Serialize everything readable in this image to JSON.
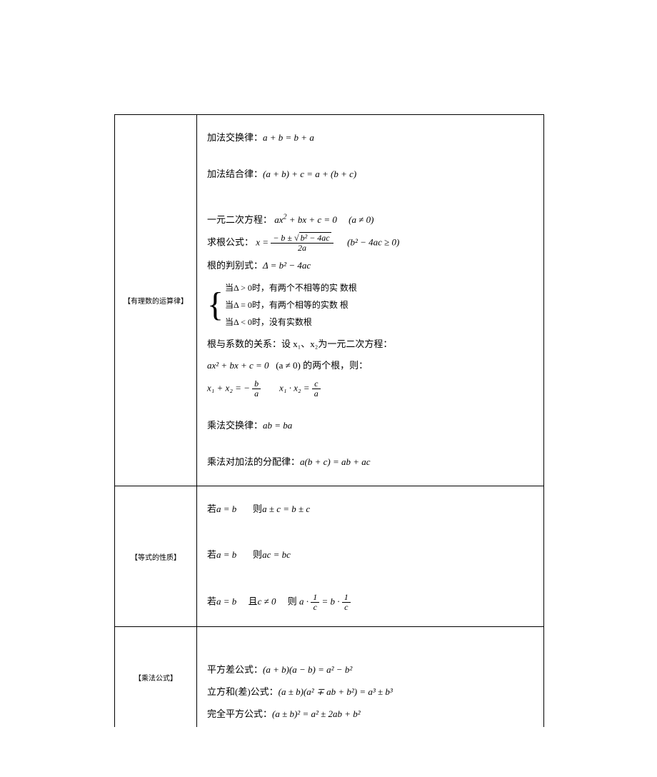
{
  "row1": {
    "label": "【有理数的运算律】",
    "l1a": "加法交换律：",
    "l1b": "a + b = b + a",
    "l2a": "加法结合律：",
    "l2b": "(a + b) + c = a + (b + c)",
    "l3a": "一元二次方程：",
    "l3b": "ax",
    "l3c": " + bx + c = 0",
    "l3d": "(a ≠ 0)",
    "l4a": "求根公式：",
    "l4b": "x = ",
    "l4num": "− b ± ",
    "l4sqrt": "b² − 4ac",
    "l4den": "2a",
    "l4c": "(b² − 4ac ≥ 0)",
    "l5a": "根的判别式：",
    "l5b": "Δ = b² − 4ac",
    "l6a": "当Δ > 0时，有两个不相等的实 数根",
    "l6b": "当Δ = 0时，有两个相等的实数 根",
    "l6c": "当Δ < 0时，没有实数根",
    "l7a": "根与系数的关系：设 x₁、x₂为一元二次方程：",
    "l8a": "ax² + bx + c = 0",
    "l8b": "(a ≠ 0) 的两个根，则：",
    "l9a": "x₁ + x₂ = − ",
    "l9n1": "b",
    "l9d1": "a",
    "l9b": "x₁ · x₂ = ",
    "l9n2": "c",
    "l9d2": "a",
    "l10a": "乘法交换律：",
    "l10b": "ab = ba",
    "l11a": "乘法对加法的分配律：",
    "l11b": "a(b + c) = ab + ac"
  },
  "row2": {
    "label": "【等式的性质】",
    "l1a": "若",
    "l1b": "a = b",
    "l1c": "则",
    "l1d": "a ± c = b ± c",
    "l2a": "若",
    "l2b": "a = b",
    "l2c": "则",
    "l2d": "ac = bc",
    "l3a": "若",
    "l3b": "a = b",
    "l3c": "且",
    "l3d": "c ≠ 0",
    "l3e": "则",
    "l3f": "a · ",
    "l3n1": "1",
    "l3d1": "c",
    "l3g": " = b · ",
    "l3n2": "1",
    "l3d2": "c"
  },
  "row3": {
    "label": "【乘法公式】",
    "l1a": "平方差公式：",
    "l1b": "(a + b)(a − b) = a² − b²",
    "l2a": "立方和(差)公式：",
    "l2b": "(a ± b)(a² ∓ ab + b²) = a³ ± b³",
    "l3a": "完全平方公式：",
    "l3b": "(a ± b)² = a² ± 2ab + b²"
  }
}
